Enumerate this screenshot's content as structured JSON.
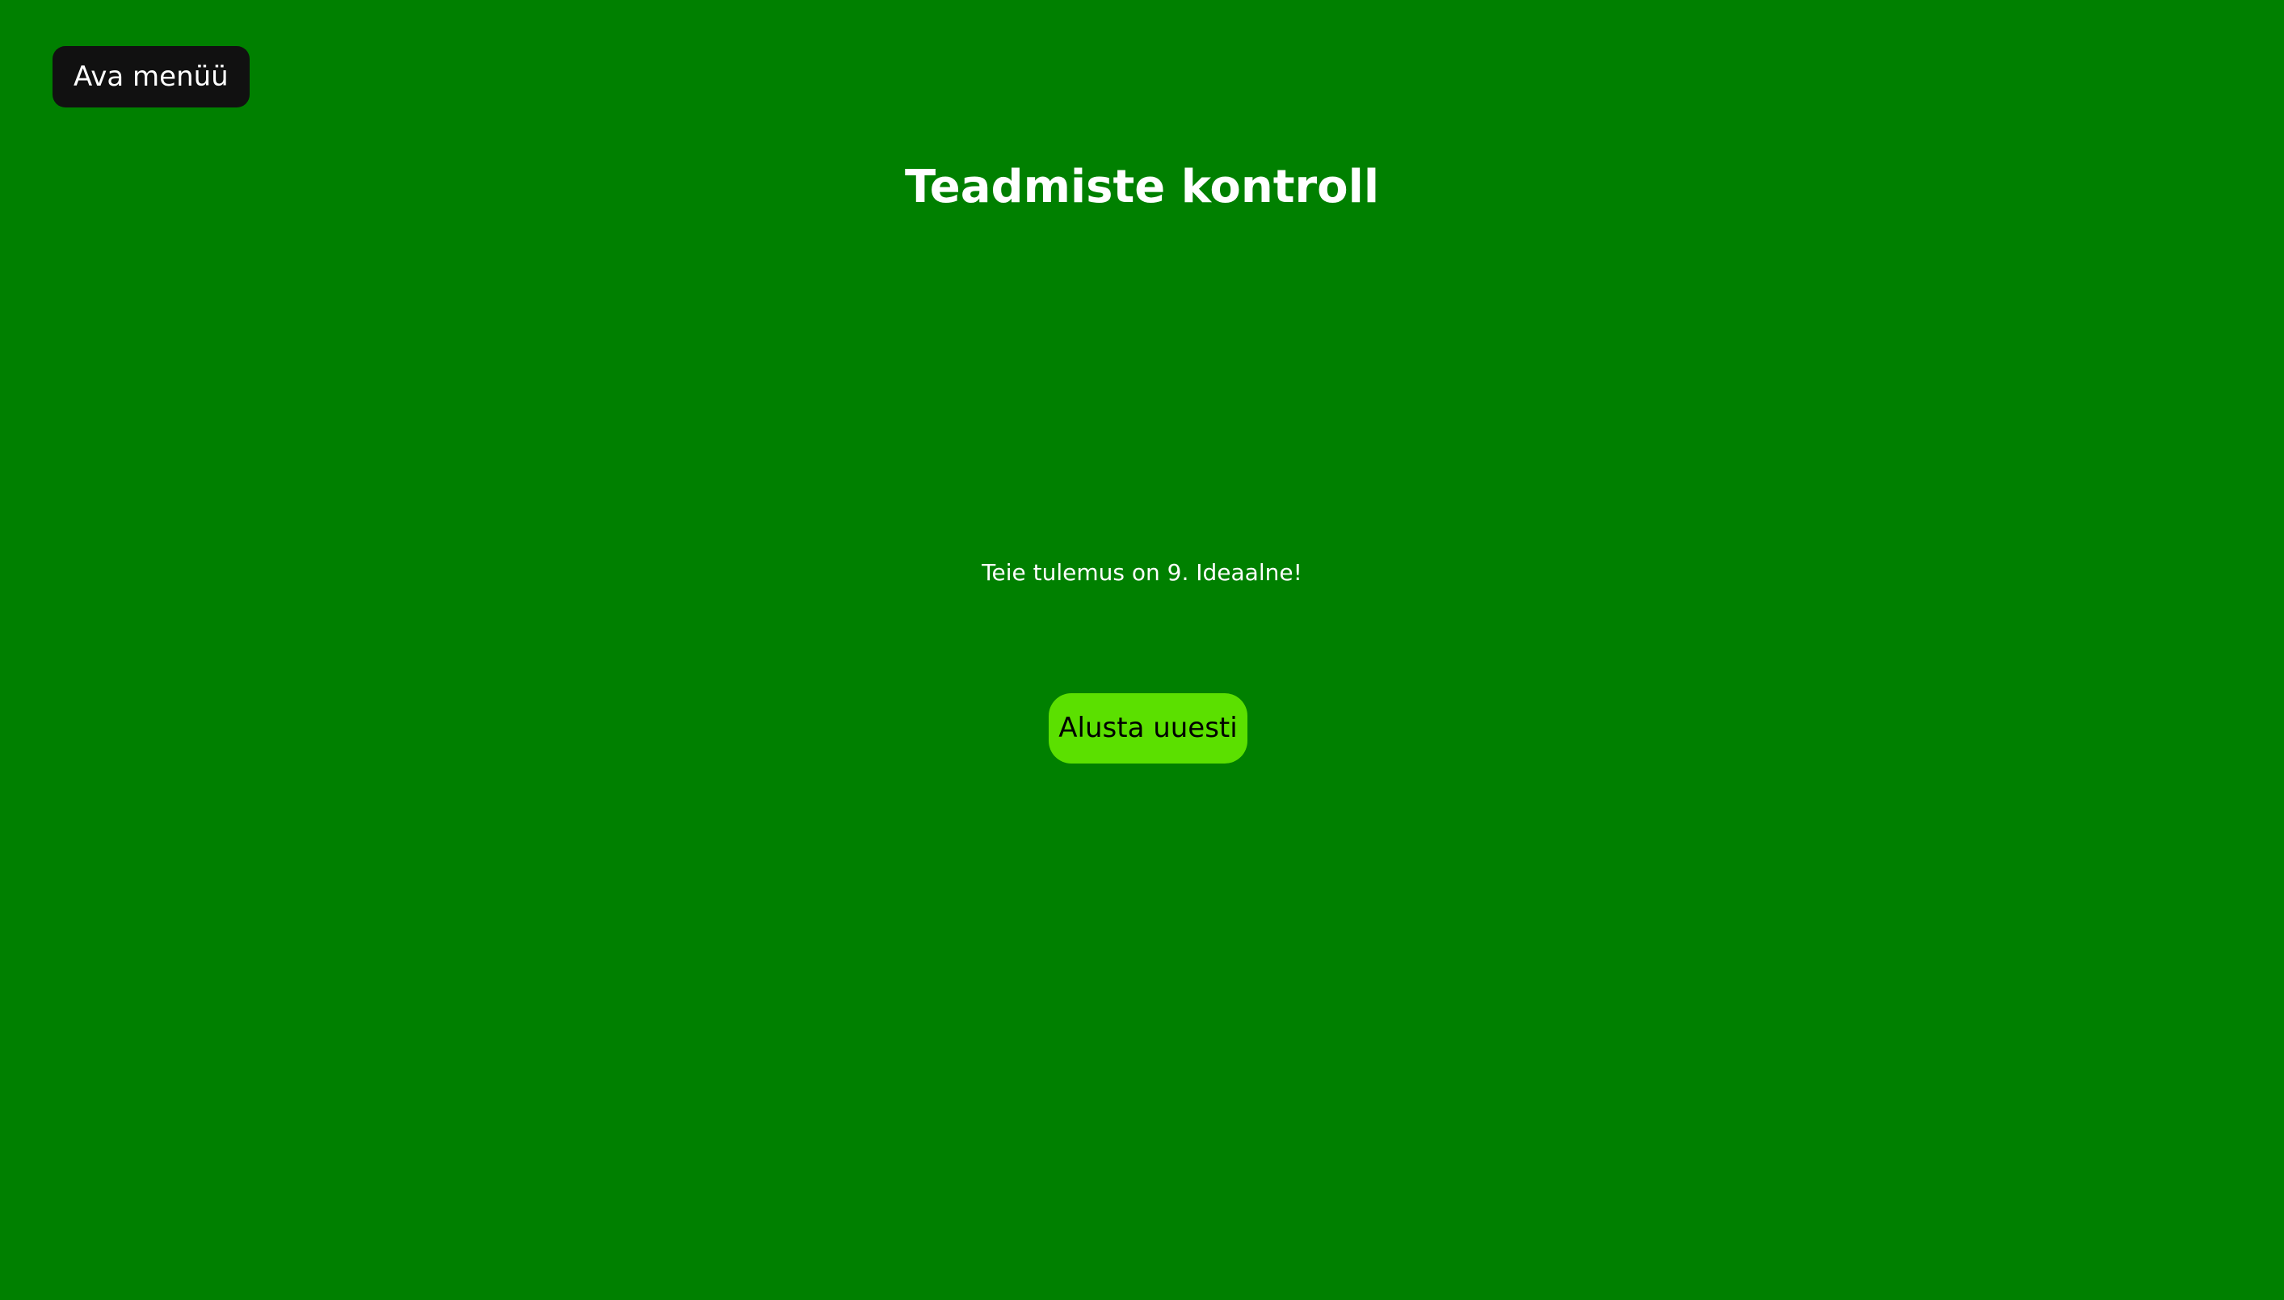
{
  "menu": {
    "open_label": "Ava menüü"
  },
  "page": {
    "title": "Teadmiste kontroll"
  },
  "result": {
    "text": "Teie tulemus on 9. Ideaalne!"
  },
  "actions": {
    "restart_label": "Alusta uuesti"
  },
  "colors": {
    "background": "#008000",
    "menu_button": "#111111",
    "restart_button": "#5be000",
    "text_light": "#ffffff",
    "text_dark": "#000000"
  }
}
